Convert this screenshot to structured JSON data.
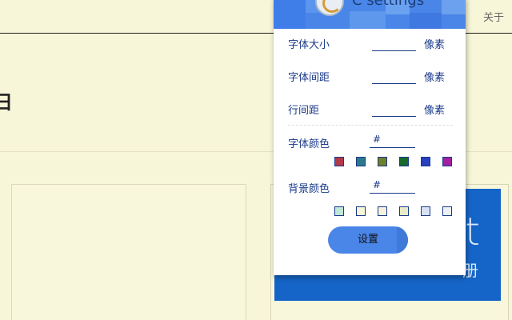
{
  "page": {
    "about_link": "关于",
    "heading_fragment": "日",
    "sub_fragment": "‹",
    "banner_text": "t",
    "banner_sub": "册"
  },
  "popup": {
    "title": "C settings",
    "rows": {
      "font_size_label": "字体大小",
      "font_size_unit": "像素",
      "font_size_value": "",
      "letter_spacing_label": "字体间距",
      "letter_spacing_unit": "像素",
      "letter_spacing_value": "",
      "line_spacing_label": "行间距",
      "line_spacing_unit": "像素",
      "line_spacing_value": ""
    },
    "font_color": {
      "label": "字体颜色",
      "value": "#",
      "swatches": [
        "#b03a4a",
        "#2a7a8c",
        "#6f7f2a",
        "#176a2e",
        "#2840c0",
        "#a020a0"
      ]
    },
    "bg_color": {
      "label": "背景颜色",
      "value": "#",
      "swatches": [
        "#bfe8d9",
        "#f7f6d8",
        "#f6f2dc",
        "#e8ecc8",
        "#d8e2f4",
        "#ecf1f8"
      ]
    },
    "submit_label": "设置"
  }
}
